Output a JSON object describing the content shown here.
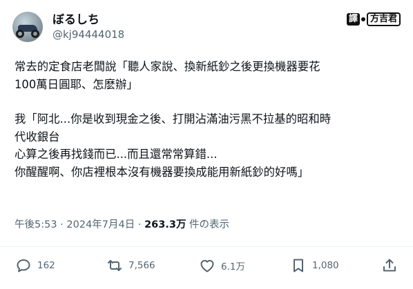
{
  "author": {
    "display_name": "ぼるしち",
    "handle": "@kj94444018"
  },
  "watermark": {
    "box_label": "譯",
    "text": "方吉君"
  },
  "post": {
    "lines": [
      "常去的定食店老闆說「聽人家說、換新紙鈔之後更換機器要花",
      "100萬日圓耶、怎麽辦」",
      "",
      "我「阿北...你是收到現金之後、打開沾滿油污黑不拉基的昭和時",
      "代收銀台",
      "心算之後再找錢而已...而且還常常算錯...",
      "你醒醒啊、你店裡根本沒有機器要換成能用新紙鈔的好嗎」"
    ]
  },
  "meta": {
    "time": "午後5:53",
    "separator": " · ",
    "date": "2024年7月4日",
    "views": "263.3万",
    "views_label": " 件の表示"
  },
  "actions": {
    "replies": "162",
    "retweets": "7,566",
    "likes": "6.1万",
    "bookmarks": "1,080"
  },
  "colors": {
    "text": "#0f1419",
    "secondary": "#536471",
    "divider": "#eff3f4"
  },
  "icons": [
    "reply-icon",
    "retweet-icon",
    "like-icon",
    "bookmark-icon",
    "share-icon"
  ]
}
